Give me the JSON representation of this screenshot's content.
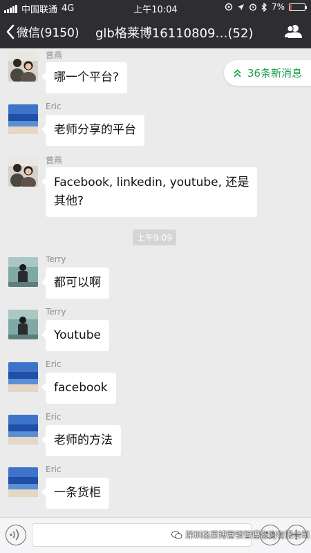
{
  "status_bar": {
    "carrier": "中国联通",
    "network": "4G",
    "time": "上午10:04",
    "battery_percent": "7%"
  },
  "header": {
    "back_label": "微信(9150)",
    "title": "glb格莱博16110809…(52)"
  },
  "unread_banner": {
    "label": "36条新消息",
    "accent": "#19a04b"
  },
  "timestamp": "上午9:09",
  "messages": [
    {
      "sender": "曾燕",
      "text": "哪一个平台?",
      "avatar": "couple-photo"
    },
    {
      "sender": "Eric",
      "text": "老师分享的平台",
      "avatar": "sea-photo"
    },
    {
      "sender": "曾燕",
      "text": "Facebook, linkedin, youtube, 还是其他?",
      "line1": "Facebook, linkedin, youtube, 还是",
      "line2": "其他?",
      "avatar": "couple-photo"
    },
    {
      "sender": "Terry",
      "text": "都可以啊",
      "avatar": "person-photo"
    },
    {
      "sender": "Terry",
      "text": "Youtube",
      "avatar": "person-photo"
    },
    {
      "sender": "Eric",
      "text": "facebook",
      "avatar": "sea-photo"
    },
    {
      "sender": "Eric",
      "text": "老师的方法",
      "avatar": "sea-photo"
    },
    {
      "sender": "Eric",
      "text": "一条货柜",
      "avatar": "sea-photo"
    }
  ],
  "watermark": "深圳格莱博营销管理咨询有限公司",
  "icons": [
    "signal-icon",
    "location-icon",
    "alarm-icon",
    "bluetooth-icon",
    "battery-icon",
    "back-chevron-icon",
    "group-members-icon",
    "double-chevron-up-icon",
    "voice-icon",
    "emoji-icon",
    "plus-icon",
    "wechat-logo-icon"
  ],
  "colors": {
    "nav_bg": "#2e2e32",
    "chat_bg": "#ebebeb",
    "bubble": "#ffffff",
    "accent_green": "#19a04b"
  }
}
